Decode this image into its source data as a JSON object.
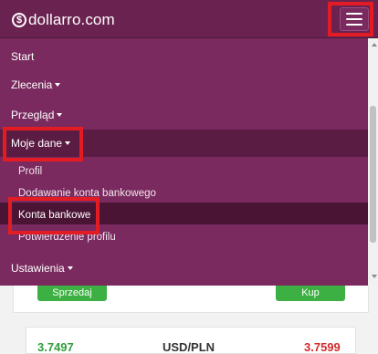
{
  "brand": {
    "icon": "dollar-circle-icon",
    "name": "dollarro.com"
  },
  "toggler": {
    "icon": "hamburger-menu-icon"
  },
  "menu": {
    "items": [
      {
        "label": "Start",
        "has_dropdown": false
      },
      {
        "label": "Zlecenia",
        "has_dropdown": true
      },
      {
        "label": "Przegląd",
        "has_dropdown": true
      },
      {
        "label": "Moje dane",
        "has_dropdown": true,
        "expanded": true
      },
      {
        "label": "Ustawienia",
        "has_dropdown": true
      }
    ],
    "submenu": [
      {
        "label": "Profil"
      },
      {
        "label": "Dodawanie konta bankowego"
      },
      {
        "label": "Konta bankowe",
        "active": true
      },
      {
        "label": "Potwierdzenie profilu"
      }
    ]
  },
  "background": {
    "sell_label": "Sprzedaj",
    "buy_label": "Kup",
    "rate_left": "3.7497",
    "pair": "USD/PLN",
    "rate_right": "3.7599"
  },
  "colors": {
    "header": "#6a2250",
    "menu": "#7a2a5e",
    "highlight": "#e31c23",
    "button": "#3cb043"
  }
}
